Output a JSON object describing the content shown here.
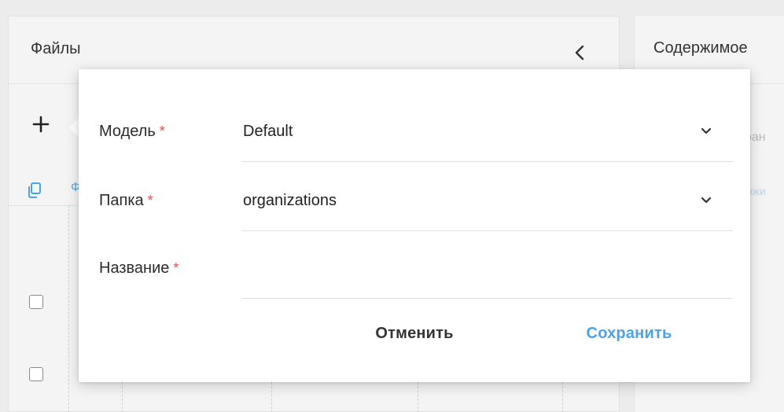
{
  "background": {
    "files_panel": {
      "title": "Файлы",
      "toolbar_link_fragment": "Ф"
    },
    "content_panel": {
      "title": "Содержимое",
      "fragment1": "ран",
      "fragment2": "ожи"
    }
  },
  "dialog": {
    "fields": {
      "model": {
        "label": "Модель",
        "required_mark": "*",
        "value": "Default"
      },
      "folder": {
        "label": "Папка",
        "required_mark": "*",
        "value": "organizations"
      },
      "name": {
        "label": "Название",
        "required_mark": "*",
        "value": "",
        "placeholder": ""
      }
    },
    "actions": {
      "cancel_label": "Отменить",
      "save_label": "Сохранить"
    }
  },
  "colors": {
    "accent": "#4aa3e6",
    "required": "#e44d4d",
    "field_underline": "#d3e3f3"
  },
  "icons": {
    "collapse": "chevron-left-icon",
    "add": "plus-icon",
    "copy": "copy-icon",
    "dropdown": "chevron-down-icon"
  }
}
